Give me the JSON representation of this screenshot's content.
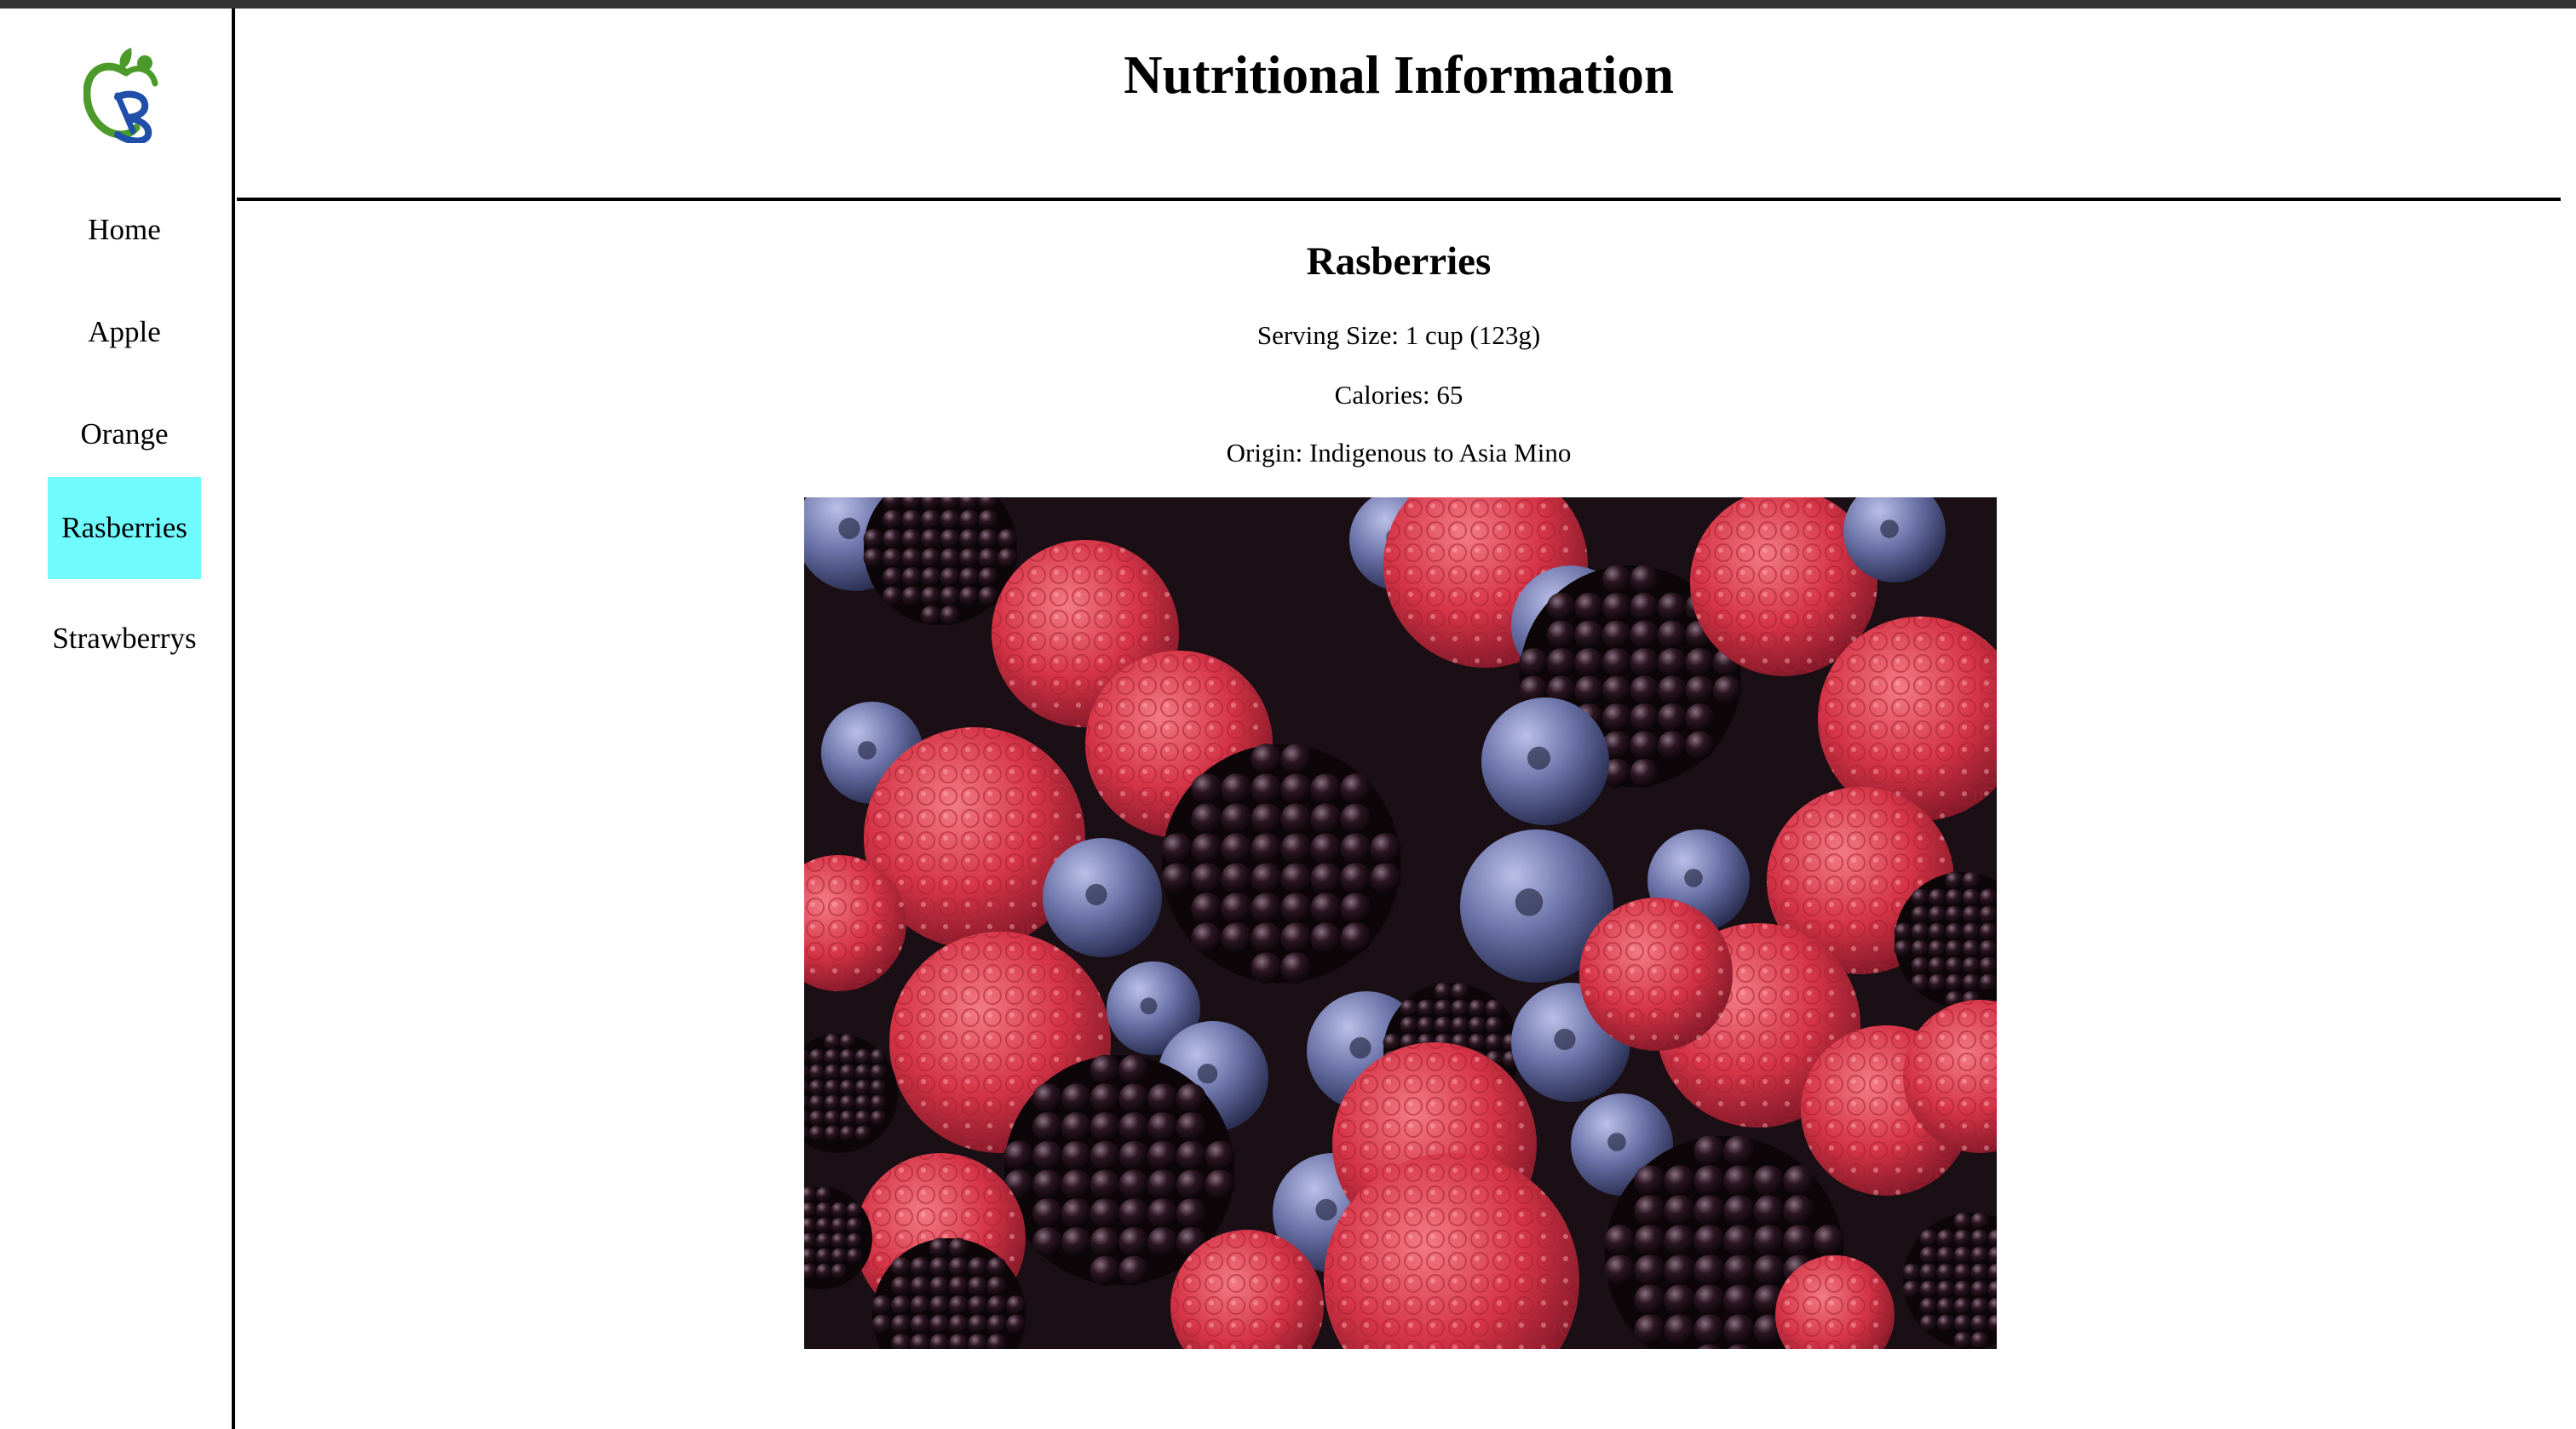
{
  "page": {
    "title": "Nutritional Information",
    "accent_color": "#70fbff"
  },
  "sidebar": {
    "logo_icon": "apple-logo-icon",
    "items": [
      {
        "label": "Home",
        "active": false
      },
      {
        "label": "Apple",
        "active": false
      },
      {
        "label": "Orange",
        "active": false
      },
      {
        "label": "Rasberries",
        "active": true
      },
      {
        "label": "Strawberrys",
        "active": false
      }
    ]
  },
  "fruit": {
    "name": "Rasberries",
    "serving_size": "Serving Size: 1 cup (123g)",
    "calories": "Calories: 65",
    "origin": "Origin: Indigenous to Asia Mino",
    "image_subject": "mixed-berries-photo"
  }
}
